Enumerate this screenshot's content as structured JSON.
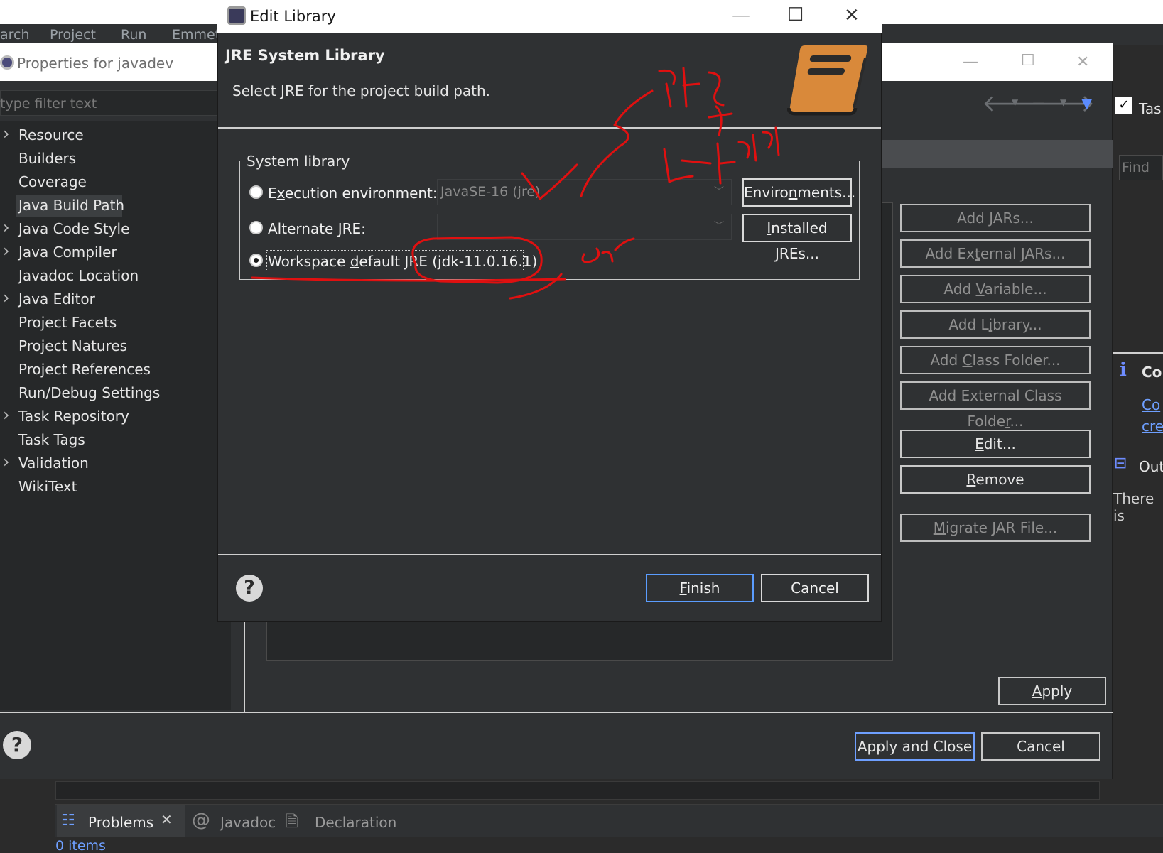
{
  "menubar": {
    "items": [
      "arch",
      "Project",
      "Run",
      "Emmet"
    ]
  },
  "properties_window": {
    "title": "Properties for javadev",
    "filter_placeholder": "type filter text",
    "tree": [
      {
        "label": "Resource",
        "expandable": true
      },
      {
        "label": "Builders",
        "expandable": false
      },
      {
        "label": "Coverage",
        "expandable": false
      },
      {
        "label": "Java Build Path",
        "expandable": false,
        "selected": true
      },
      {
        "label": "Java Code Style",
        "expandable": true
      },
      {
        "label": "Java Compiler",
        "expandable": true
      },
      {
        "label": "Javadoc Location",
        "expandable": false
      },
      {
        "label": "Java Editor",
        "expandable": true
      },
      {
        "label": "Project Facets",
        "expandable": false
      },
      {
        "label": "Project Natures",
        "expandable": false
      },
      {
        "label": "Project References",
        "expandable": false
      },
      {
        "label": "Run/Debug Settings",
        "expandable": false
      },
      {
        "label": "Task Repository",
        "expandable": true
      },
      {
        "label": "Task Tags",
        "expandable": false
      },
      {
        "label": "Validation",
        "expandable": true
      },
      {
        "label": "WikiText",
        "expandable": false
      }
    ],
    "buttons": {
      "add_jars": "Add JARs...",
      "add_external_jars": "Add External JARs...",
      "add_variable": "Add Variable...",
      "add_library": "Add Library...",
      "add_class_folder": "Add Class Folder...",
      "add_external_class_folder": "Add External Class Folder...",
      "edit": "Edit...",
      "remove": "Remove",
      "migrate_jar": "Migrate JAR File...",
      "apply": "Apply",
      "apply_and_close": "Apply and Close",
      "cancel": "Cancel"
    }
  },
  "dialog": {
    "title": "Edit Library",
    "heading": "JRE System Library",
    "description": "Select JRE for the project build path.",
    "group_label": "System library",
    "options": {
      "execution_environment": "Execution environment:",
      "execution_environment_value": "JavaSE-16 (jre)",
      "alternate_jre": "Alternate JRE:",
      "alternate_jre_value": "",
      "workspace_default": "Workspace default JRE (jdk-11.0.16.1)"
    },
    "selected_option": "workspace_default",
    "buttons": {
      "environments": "Environments...",
      "installed_jres": "Installed JREs...",
      "finish": "Finish",
      "cancel": "Cancel"
    }
  },
  "right_view": {
    "tasks_label": "Tas",
    "find_placeholder": "Find",
    "info_title": "Co",
    "info_link_1": "Co",
    "info_link_2": "cre",
    "outline_label": "Out",
    "outline_text": "There is"
  },
  "bottom_panel": {
    "tabs": [
      "Problems",
      "Javadoc",
      "Declaration"
    ],
    "status": "0 items"
  },
  "annotation": {
    "color": "#e01010",
    "handwritten_text": [
      "기껍",
      "바꾸기",
      "or"
    ]
  }
}
